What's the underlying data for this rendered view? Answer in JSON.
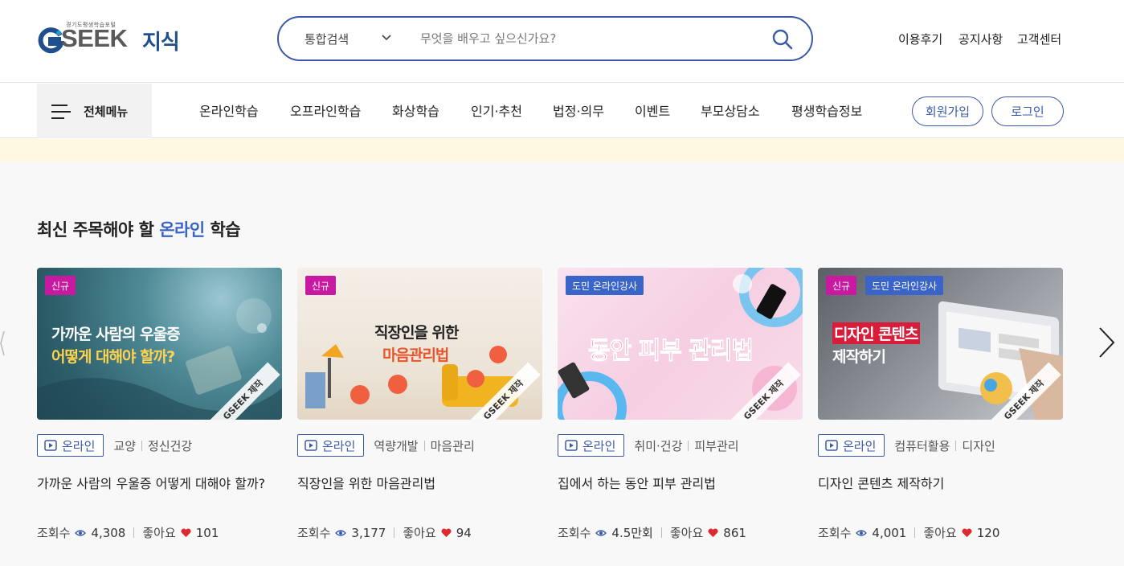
{
  "logo": {
    "tagline": "경기도평생학습포털",
    "brand": "SEEK",
    "sub": "지식"
  },
  "search": {
    "category": "통합검색",
    "placeholder": "무엇을 배우고 싶으신가요?"
  },
  "utility": [
    "이용후기",
    "공지사항",
    "고객센터"
  ],
  "nav": {
    "all_menu": "전체메뉴",
    "items": [
      "온라인학습",
      "오프라인학습",
      "화상학습",
      "인기·추천",
      "법정·의무",
      "이벤트",
      "부모상담소",
      "평생학습정보"
    ],
    "signup": "회원가입",
    "login": "로그인"
  },
  "section": {
    "title_prefix": "최신 주목해야 할 ",
    "title_accent": "온라인",
    "title_suffix": " 학습"
  },
  "labels": {
    "online": "온라인",
    "views": "조회수",
    "likes": "좋아요",
    "watermark": "GSEEK 제작",
    "badge_new": "신규",
    "badge_tutor": "도민 온라인강사"
  },
  "cards": [
    {
      "thumb_line1": "가까운 사람의 우울증",
      "thumb_line2": "어떻게 대해야 할까?",
      "categories": [
        "교양",
        "정신건강"
      ],
      "title": "가까운 사람의 우울증 어떻게 대해야 할까?",
      "views": "4,308",
      "likes": "101"
    },
    {
      "thumb_line1": "직장인을 위한",
      "thumb_line2": "마음관리법",
      "categories": [
        "역량개발",
        "마음관리"
      ],
      "title": "직장인을 위한 마음관리법",
      "views": "3,177",
      "likes": "94"
    },
    {
      "thumb_line1": "동안 피부 관리법",
      "thumb_line2": "",
      "categories": [
        "취미·건강",
        "피부관리"
      ],
      "title": "집에서 하는 동안 피부 관리법",
      "views": "4.5만회",
      "likes": "861"
    },
    {
      "thumb_line1": "디자인 콘텐츠",
      "thumb_line2": "제작하기",
      "categories": [
        "컴퓨터활용",
        "디자인"
      ],
      "title": "디자인 콘텐츠 제작하기",
      "views": "4,001",
      "likes": "120"
    }
  ],
  "colors": {
    "primary": "#3a5aa8",
    "accent": "#3a64c8",
    "badge_new": "#c81aa0",
    "heart": "#e0282e",
    "banner": "#fff8e1"
  }
}
